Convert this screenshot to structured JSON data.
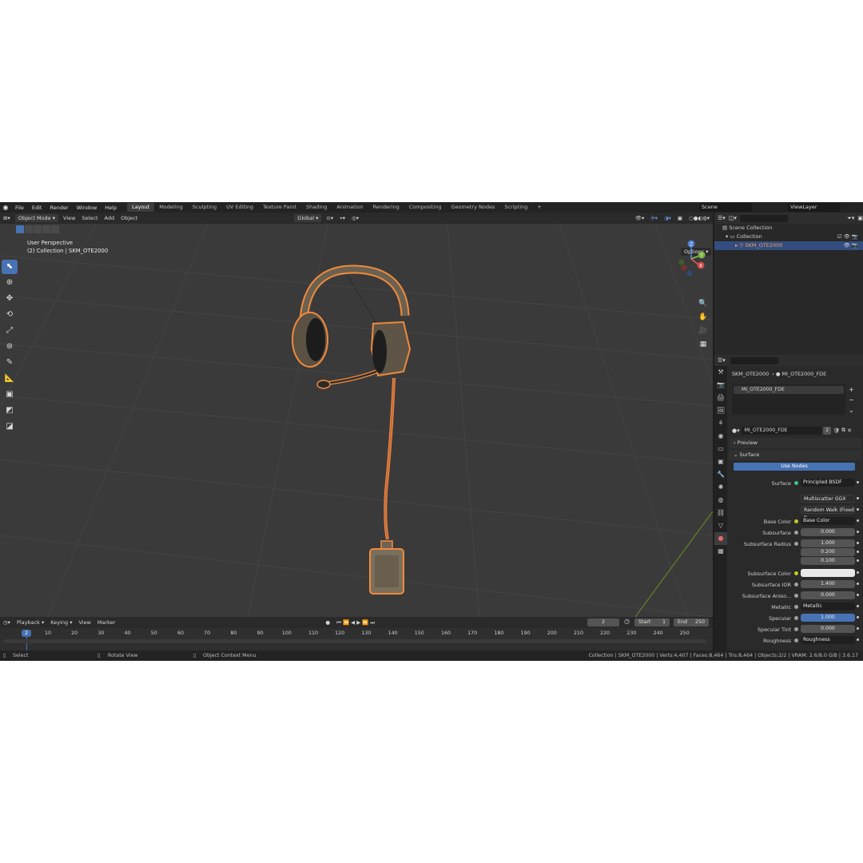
{
  "menu": [
    "File",
    "Edit",
    "Render",
    "Window",
    "Help"
  ],
  "workspaces": [
    "Layout",
    "Modeling",
    "Sculpting",
    "UV Editing",
    "Texture Paint",
    "Shading",
    "Animation",
    "Rendering",
    "Compositing",
    "Geometry Nodes",
    "Scripting"
  ],
  "active_workspace": "Layout",
  "scene": "Scene",
  "view_layer": "ViewLayer",
  "viewport_header": {
    "mode": "Object Mode",
    "menus": [
      "View",
      "Select",
      "Add",
      "Object"
    ],
    "orientation": "Global",
    "options": "Options"
  },
  "viewport": {
    "perspective": "User Perspective",
    "collection_line": "(2) Collection | SKM_OTE2000",
    "gizmo_axes": [
      "Z",
      "Y",
      "X"
    ]
  },
  "outliner": {
    "scene_collection": "Scene Collection",
    "collection": "Collection",
    "object": "SKM_OTE2000"
  },
  "properties": {
    "breadcrumb_object": "SKM_OTE2000",
    "breadcrumb_material": "MI_OTE2000_FDE",
    "slot": "MI_OTE2000_FDE",
    "material_name": "MI_OTE2000_FDE",
    "users": "2",
    "preview": "Preview",
    "surface_panel": "Surface",
    "use_nodes": "Use Nodes",
    "rows": [
      {
        "label": "Surface",
        "value": "Principled BSDF",
        "style": "dark"
      },
      {
        "label": "",
        "value": "Multiscatter GGX",
        "style": "dropdown"
      },
      {
        "label": "",
        "value": "Random Walk (Fixed R...",
        "style": "dropdown"
      },
      {
        "label": "Base Color",
        "value": "Base Color",
        "style": "dark"
      },
      {
        "label": "Subsurface",
        "value": "0.000",
        "style": "num"
      },
      {
        "label": "Subsurface Radius",
        "value": "1.000",
        "style": "num"
      },
      {
        "label": "",
        "value": "0.200",
        "style": "num"
      },
      {
        "label": "",
        "value": "0.100",
        "style": "num"
      },
      {
        "label": "Subsurface Color",
        "value": "",
        "style": "white"
      },
      {
        "label": "Subsurface IOR",
        "value": "1.400",
        "style": "num"
      },
      {
        "label": "Subsurface Aniso...",
        "value": "0.000",
        "style": "num"
      },
      {
        "label": "Metallic",
        "value": "Metallic",
        "style": "dark"
      },
      {
        "label": "Specular",
        "value": "1.000",
        "style": "blue"
      },
      {
        "label": "Specular Tint",
        "value": "0.000",
        "style": "num"
      },
      {
        "label": "Roughness",
        "value": "Roughness",
        "style": "dark"
      }
    ]
  },
  "timeline": {
    "menus": [
      "Playback",
      "Keying",
      "View",
      "Marker"
    ],
    "current_frame": "2",
    "start_label": "Start",
    "start": "1",
    "end_label": "End",
    "end": "250",
    "ticks": [
      "10",
      "20",
      "30",
      "40",
      "50",
      "60",
      "70",
      "80",
      "90",
      "100",
      "110",
      "120",
      "130",
      "140",
      "150",
      "160",
      "170",
      "180",
      "190",
      "200",
      "210",
      "220",
      "230",
      "240",
      "250"
    ]
  },
  "status_bar": {
    "select": "Select",
    "rotate": "Rotate View",
    "context": "Object Context Menu",
    "stats": "Collection | SKM_OTE2000 | Verts:4,407 | Faces:8,464 | Tris:8,464 | Objects:2/2 | VRAM: 2.6/8.0 GiB | 3.6.17"
  },
  "colors": {
    "accent": "#4772b3",
    "selection_outline": "#f08a3c",
    "viewport_bg": "#3a3a3a"
  }
}
